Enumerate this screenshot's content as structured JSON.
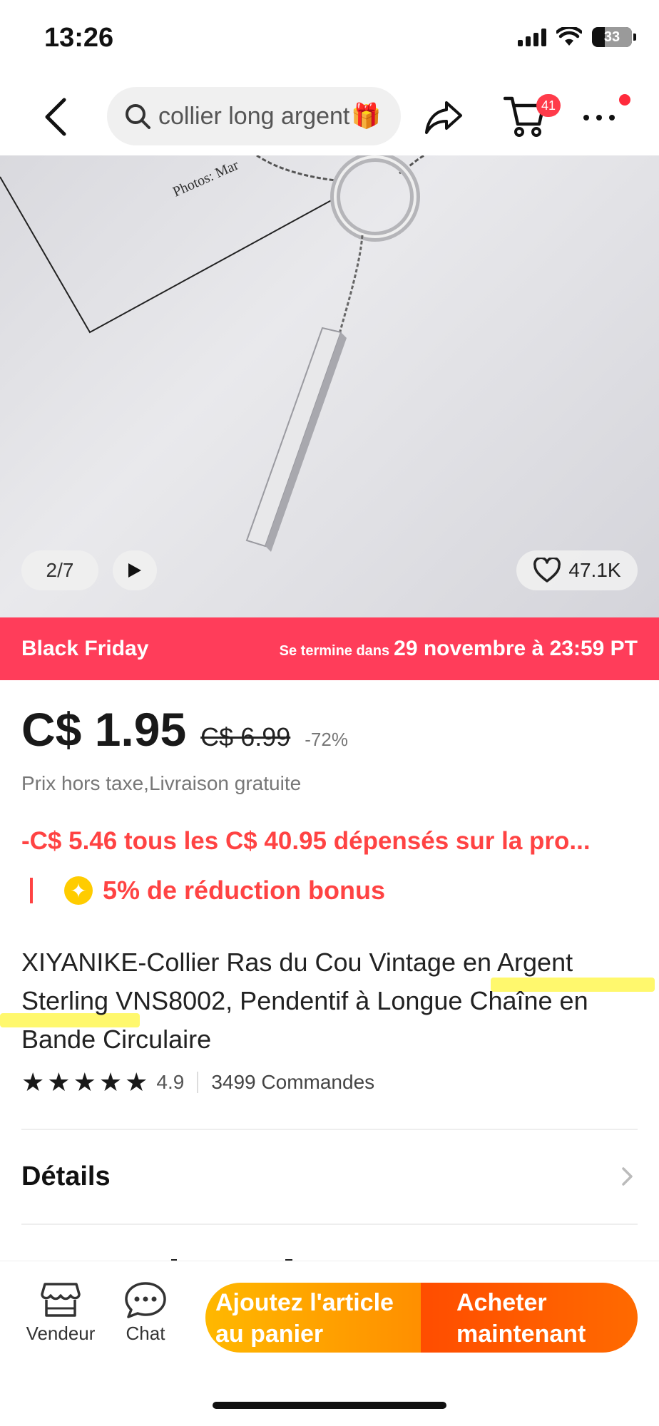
{
  "status_bar": {
    "time": "13:26",
    "battery": "33",
    "battery_level": 0.33
  },
  "top_nav": {
    "search_query": "collier long argent",
    "search_emoji": "🎁",
    "cart_count": "41",
    "icons": [
      "back-arrow-icon",
      "search-icon",
      "share-icon",
      "cart-icon",
      "more-icon"
    ]
  },
  "gallery": {
    "counter": "2/7",
    "likes": "47.1K",
    "image_label_text": "Photos: Mar"
  },
  "banner": {
    "title": "Black Friday",
    "ends_prefix": "Se termine dans",
    "ends_date": "29 novembre à 23:59 PT",
    "color": "#ff3d5a"
  },
  "pricing": {
    "price": "C$ 1.95",
    "old_price": "C$ 6.99",
    "discount": "-72%",
    "tax_note": "Prix hors taxe,Livraison gratuite",
    "promo": "-C$ 5.46 tous les C$ 40.95 dépensés sur la pro...",
    "bonus_divider": "|",
    "bonus": "5% de réduction bonus",
    "accent": "#ff4343"
  },
  "product": {
    "title": "XIYANIKE-Collier Ras du Cou Vintage en Argent Sterling VNS8002, Pendentif à Longue Chaîne en Bande Circulaire",
    "rating": "4.9",
    "stars": 5,
    "orders": "3499 Commandes"
  },
  "details": {
    "label": "Détails"
  },
  "bottom_bar": {
    "vendor_label": "Vendeur",
    "chat_label": "Chat",
    "add_to_cart_line1": "Ajoutez l'article",
    "add_to_cart_line2": "au panier",
    "buy_now_line1": "Acheter",
    "buy_now_line2": "maintenant"
  }
}
